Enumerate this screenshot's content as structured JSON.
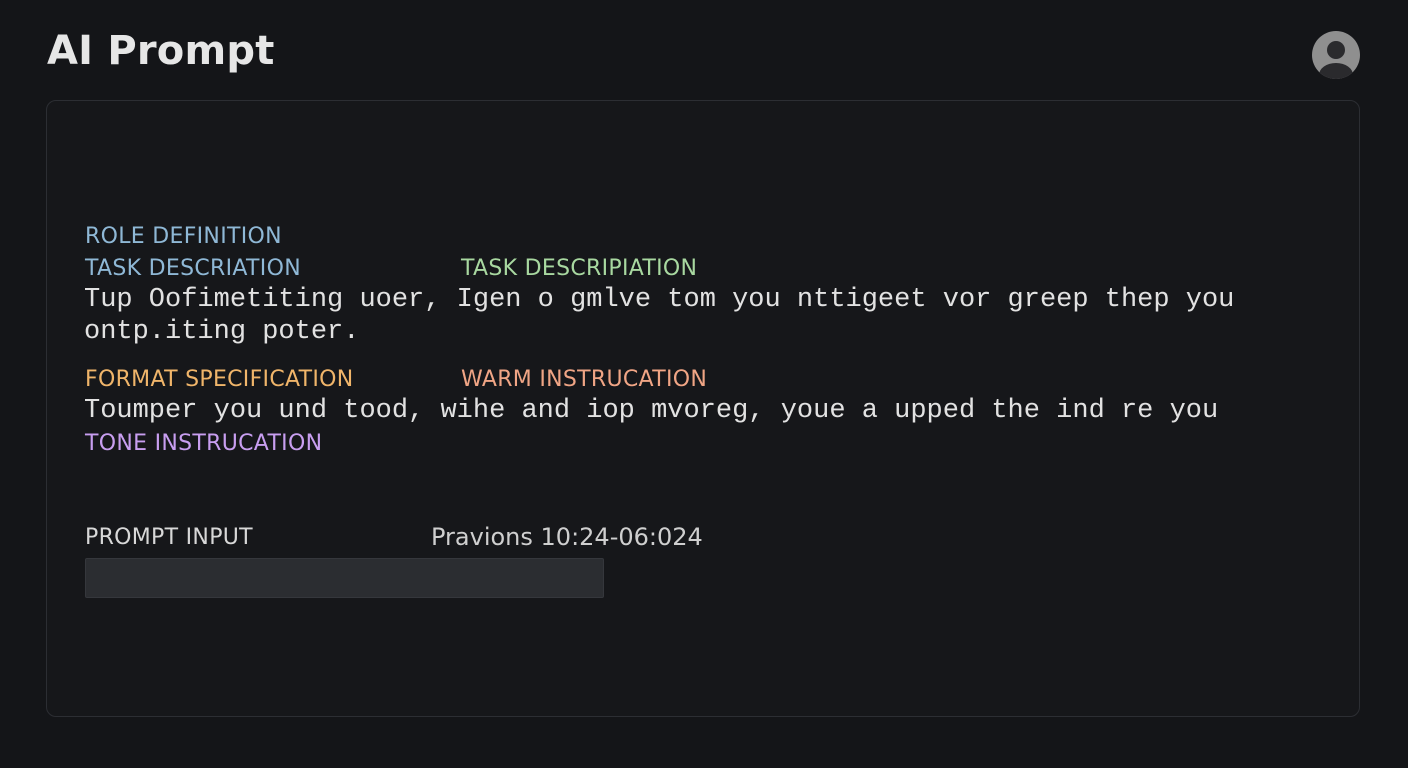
{
  "header": {
    "title": "AI Prompt",
    "avatar_icon": "user-avatar-icon"
  },
  "editor": {
    "role_definition": "ROLE DEFINITION",
    "task_description_left": "TASK DESCRIATION",
    "task_description_right": "TASK DESCRIPIATION",
    "body_line_1": "Tup Oofimetiting uoer, Igen o gmlve tom you nttigeet vor greep thep you",
    "body_line_2": "ontp.iting poter.",
    "format_specification": "FORMAT SPECIFICATION",
    "warm_instruction": "WARM INSTRUCATION",
    "body_line_3": "Toumper you und tood, wihe and iop mvoreg, youe a upped the ind re you",
    "tone_instruction": "TONE INSTRUCATION",
    "prompt_input_label": "PROMPT INPUT",
    "previous_timestamp": "Pravions 10:24-06:024",
    "prompt_input_value": ""
  },
  "colors": {
    "background": "#141518",
    "role_definition": "#8fb8d6",
    "task_description_left": "#8fb8d6",
    "task_description_right": "#a8d8a0",
    "format_specification": "#f0b56a",
    "warm_instruction": "#f0a585",
    "tone_instruction": "#c89ef0"
  }
}
